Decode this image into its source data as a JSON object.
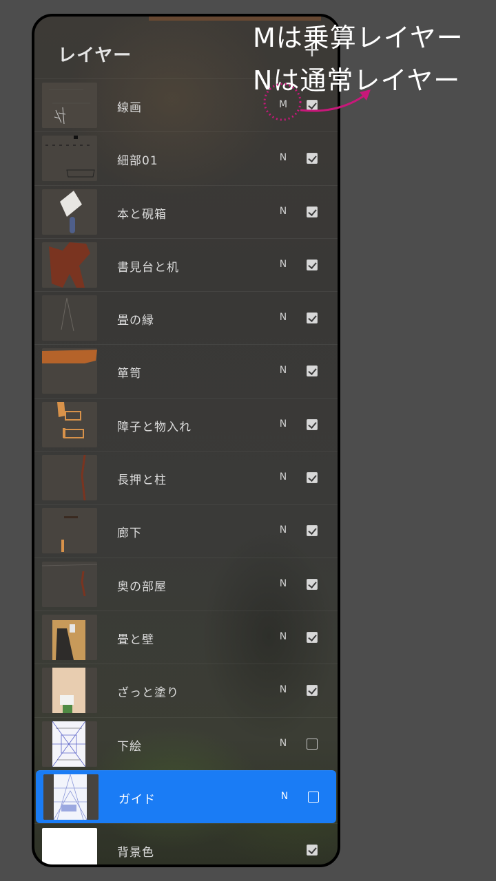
{
  "panel": {
    "title": "レイヤー",
    "add_icon": "+"
  },
  "layers": [
    {
      "name": "線画",
      "blend": "M",
      "visible": true,
      "thumb": "line-art"
    },
    {
      "name": "細部01",
      "blend": "N",
      "visible": true,
      "thumb": "details"
    },
    {
      "name": "本と硯箱",
      "blend": "N",
      "visible": true,
      "thumb": "book-box"
    },
    {
      "name": "書見台と机",
      "blend": "N",
      "visible": true,
      "thumb": "desk"
    },
    {
      "name": "畳の縁",
      "blend": "N",
      "visible": true,
      "thumb": "tatami-edge"
    },
    {
      "name": "箪笥",
      "blend": "N",
      "visible": true,
      "thumb": "chest"
    },
    {
      "name": "障子と物入れ",
      "blend": "N",
      "visible": true,
      "thumb": "shoji"
    },
    {
      "name": "長押と柱",
      "blend": "N",
      "visible": true,
      "thumb": "pillar"
    },
    {
      "name": "廊下",
      "blend": "N",
      "visible": true,
      "thumb": "corridor"
    },
    {
      "name": "奥の部屋",
      "blend": "N",
      "visible": true,
      "thumb": "back-room"
    },
    {
      "name": "畳と壁",
      "blend": "N",
      "visible": true,
      "thumb": "tatami-wall"
    },
    {
      "name": "ざっと塗り",
      "blend": "N",
      "visible": true,
      "thumb": "rough-paint"
    },
    {
      "name": "下絵",
      "blend": "N",
      "visible": false,
      "thumb": "sketch"
    },
    {
      "name": "ガイド",
      "blend": "N",
      "visible": false,
      "thumb": "guide",
      "selected": true
    },
    {
      "name": "背景色",
      "blend": "",
      "visible": true,
      "thumb": "background"
    }
  ],
  "annotations": {
    "line1": "Mは乗算レイヤー",
    "line2": "Nは通常レイヤー"
  },
  "colors": {
    "selected": "#1a7cf5",
    "annotation_marker": "#c8187a"
  }
}
